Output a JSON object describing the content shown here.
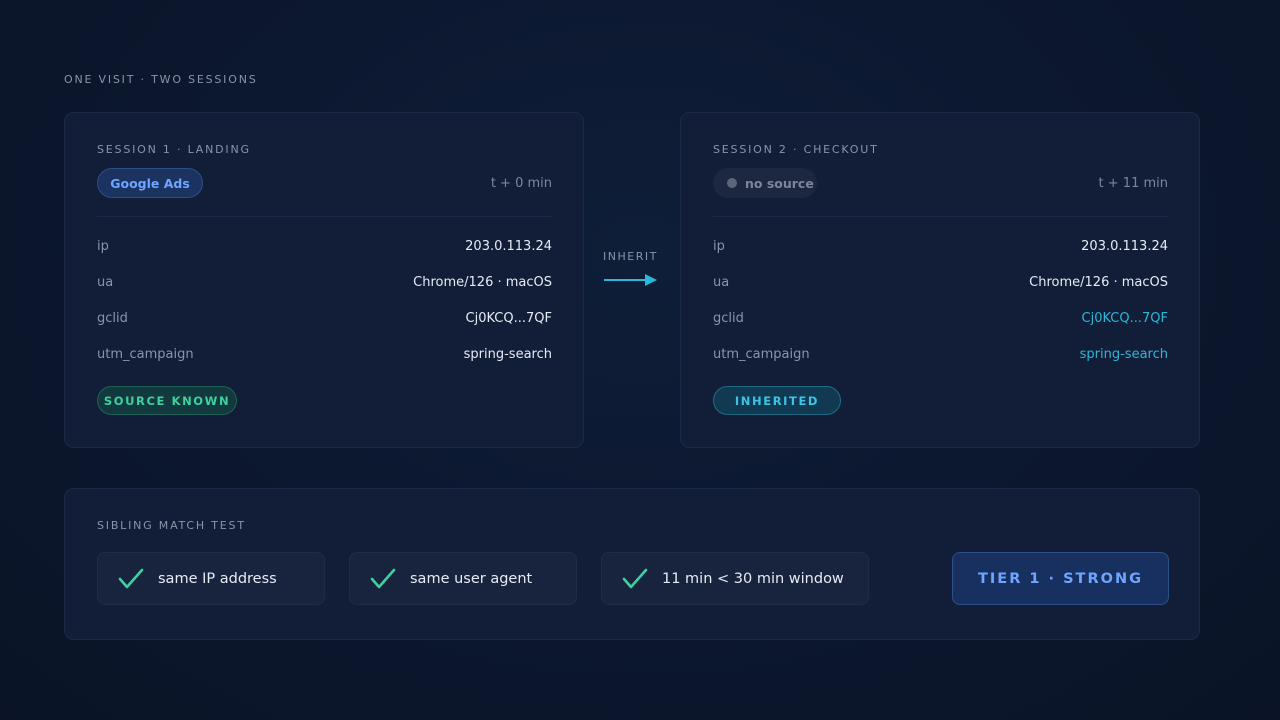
{
  "eyebrow": "ONE VISIT · TWO SESSIONS",
  "session1": {
    "title": "SESSION 1 · LANDING",
    "source_pill": "Google Ads",
    "time": "t + 0 min",
    "fields": [
      {
        "key": "ip",
        "value": "203.0.113.24"
      },
      {
        "key": "ua",
        "value": "Chrome/126 · macOS"
      },
      {
        "key": "gclid",
        "value": "Cj0KCQ...7QF"
      },
      {
        "key": "utm_campaign",
        "value": "spring-search"
      }
    ],
    "status_badge": "SOURCE KNOWN"
  },
  "connector": {
    "label": "INHERIT"
  },
  "session2": {
    "title": "SESSION 2 · CHECKOUT",
    "source_pill": "no source",
    "time": "t + 11 min",
    "fields": [
      {
        "key": "ip",
        "value": "203.0.113.24"
      },
      {
        "key": "ua",
        "value": "Chrome/126 · macOS"
      },
      {
        "key": "gclid",
        "value": "Cj0KCQ...7QF"
      },
      {
        "key": "utm_campaign",
        "value": "spring-search"
      }
    ],
    "status_badge": "INHERITED"
  },
  "match_test": {
    "title": "SIBLING MATCH TEST",
    "checks": [
      {
        "icon": "check-icon",
        "label": "same IP address"
      },
      {
        "icon": "check-icon",
        "label": "same user agent"
      },
      {
        "icon": "check-icon",
        "label": "11 min < 30 min window"
      }
    ],
    "result": "TIER 1 · STRONG"
  },
  "colors": {
    "background": "#0c1830",
    "card": "#121e38",
    "accent_blue": "#6fa5ff",
    "accent_green": "#3fd0a0",
    "accent_cyan": "#2ab8d8",
    "muted": "#8a94a8"
  }
}
